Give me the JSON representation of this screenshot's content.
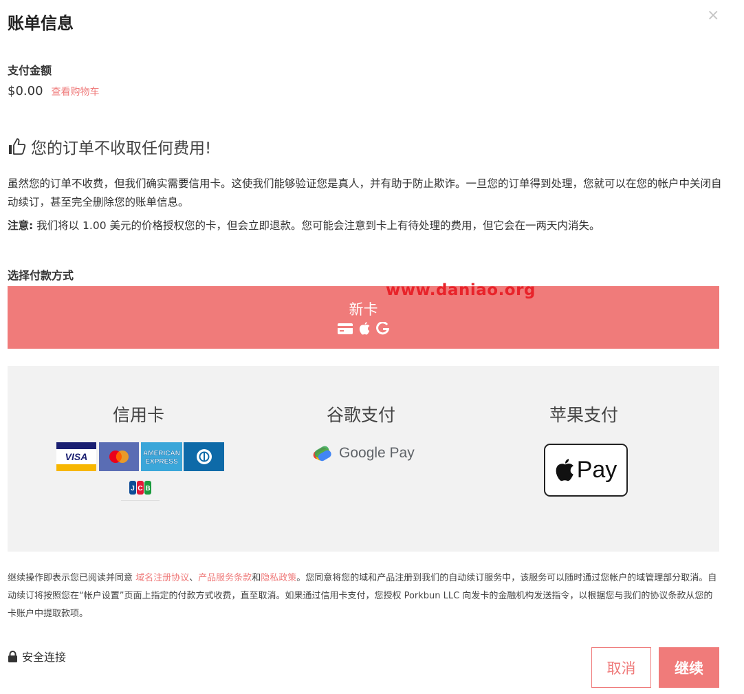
{
  "header": {
    "title": "账单信息",
    "close_label": "×"
  },
  "payment_amount": {
    "label": "支付金额",
    "value": "$0.00",
    "cart_link": "查看购物车"
  },
  "free_order": {
    "icon": "thumbs-up-icon",
    "heading": "您的订单不收取任何费用!",
    "paragraph": "虽然您的订单不收费，但我们确实需要信用卡。这使我们能够验证您是真人，并有助于防止欺诈。一旦您的订单得到处理，您就可以在您的帐户中关闭自动续订，甚至完全删除您的账单信息。",
    "note_label": "注意:",
    "note_text": " 我们将以 1.00 美元的价格授权您的卡，但会立即退款。您可能会注意到卡上有待处理的费用，但它会在一两天内消失。"
  },
  "payment_method": {
    "label": "选择付款方式",
    "new_card": {
      "label": "新卡",
      "icons": [
        "credit-card-icon",
        "apple-icon",
        "google-icon"
      ]
    },
    "watermark": "www.daniao.org",
    "options": [
      {
        "title": "信用卡",
        "brands": [
          "VISA",
          "Mastercard",
          "AMERICAN EXPRESS",
          "Diners Club",
          "JCB"
        ]
      },
      {
        "title": "谷歌支付",
        "logo_text": "Google Pay"
      },
      {
        "title": "苹果支付",
        "logo_text": "Pay"
      }
    ]
  },
  "legal": {
    "t1": "继续操作即表示您已阅读并同意 ",
    "link1": "域名注册协议",
    "t2": "、",
    "link2": "产品服务条款",
    "t3": "和",
    "link3": "隐私政策",
    "t4": "。您同意将您的域和产品注册到我们的自动续订服务中，该服务可以随时通过您帐户的域管理部分取消。自动续订将按照您在“帐户设置”页面上指定的付款方式收费，直至取消。如果通过信用卡支付，您授权 Porkbun LLC 向发卡的金融机构发送指令，以根据您与我们的协议条款从您的卡账户中提取款项。"
  },
  "footer": {
    "secure_label": "安全连接",
    "cancel_label": "取消",
    "continue_label": "继续"
  },
  "colors": {
    "accent": "#f07b7a",
    "link": "#ef7a7a",
    "panel_bg": "#f2f2f2",
    "watermark": "#e8232a"
  }
}
